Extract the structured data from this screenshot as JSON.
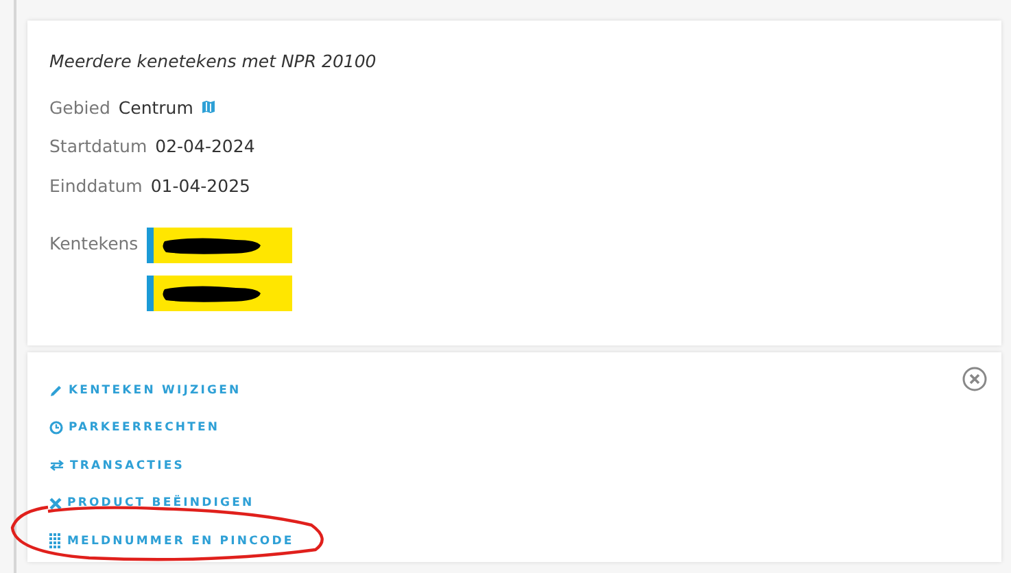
{
  "product": {
    "title": "Meerdere kenetekens met NPR 20100",
    "fields": [
      {
        "label": "Gebied",
        "value": "Centrum",
        "map_link": true
      },
      {
        "label": "Startdatum",
        "value": "02-04-2024",
        "map_link": false
      },
      {
        "label": "Einddatum",
        "value": "01-04-2025",
        "map_link": false
      }
    ],
    "plates_label": "Kentekens",
    "plates": [
      {
        "redacted": true
      },
      {
        "redacted": true
      }
    ]
  },
  "actions": [
    {
      "label": "KENTEKEN WIJZIGEN",
      "kind": "pencil",
      "circled": false
    },
    {
      "label": "PARKEERRECHTEN",
      "kind": "clock",
      "circled": false
    },
    {
      "label": "TRANSACTIES",
      "kind": "arrows",
      "circled": false
    },
    {
      "label": "PRODUCT BEËINDIGEN",
      "kind": "cross",
      "circled": false
    },
    {
      "label": "MELDNUMMER EN PINCODE",
      "kind": "keypad",
      "circled": true
    }
  ]
}
